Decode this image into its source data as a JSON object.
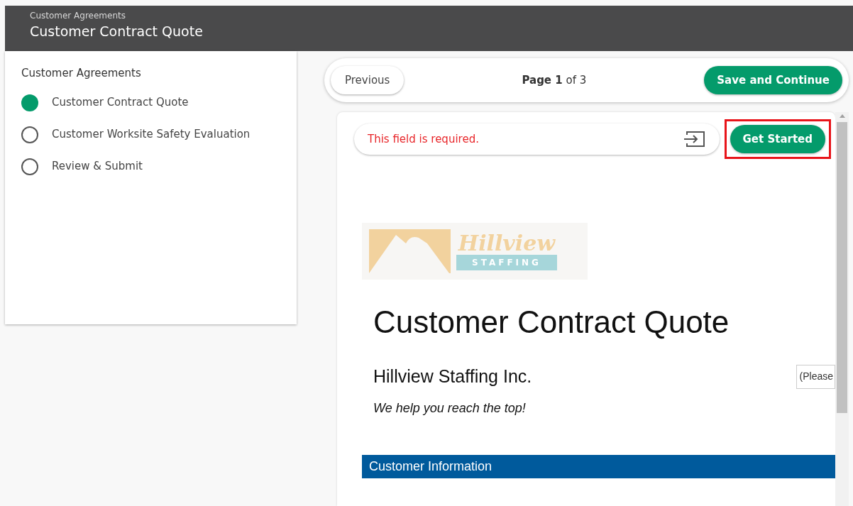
{
  "header": {
    "breadcrumb": "Customer Agreements",
    "title": "Customer Contract Quote"
  },
  "sidebar": {
    "heading": "Customer Agreements",
    "steps": [
      {
        "label": "Customer Contract Quote",
        "selected": true
      },
      {
        "label": "Customer Worksite Safety Evaluation",
        "selected": false
      },
      {
        "label": "Review & Submit",
        "selected": false
      }
    ]
  },
  "pager": {
    "previous": "Previous",
    "page_label": "**Page 1** of 3",
    "next": "Save and Continue"
  },
  "form": {
    "message": "This field is required.",
    "action": "Get Started",
    "highlighted": true,
    "logo": {
      "name": "Hillview",
      "tagline": "STAFFING"
    },
    "title": "Customer Contract Quote",
    "company": "Hillview Staffing Inc.",
    "company_field": "(Please",
    "slogan": "We help you reach the top!",
    "section": "Customer Information"
  }
}
